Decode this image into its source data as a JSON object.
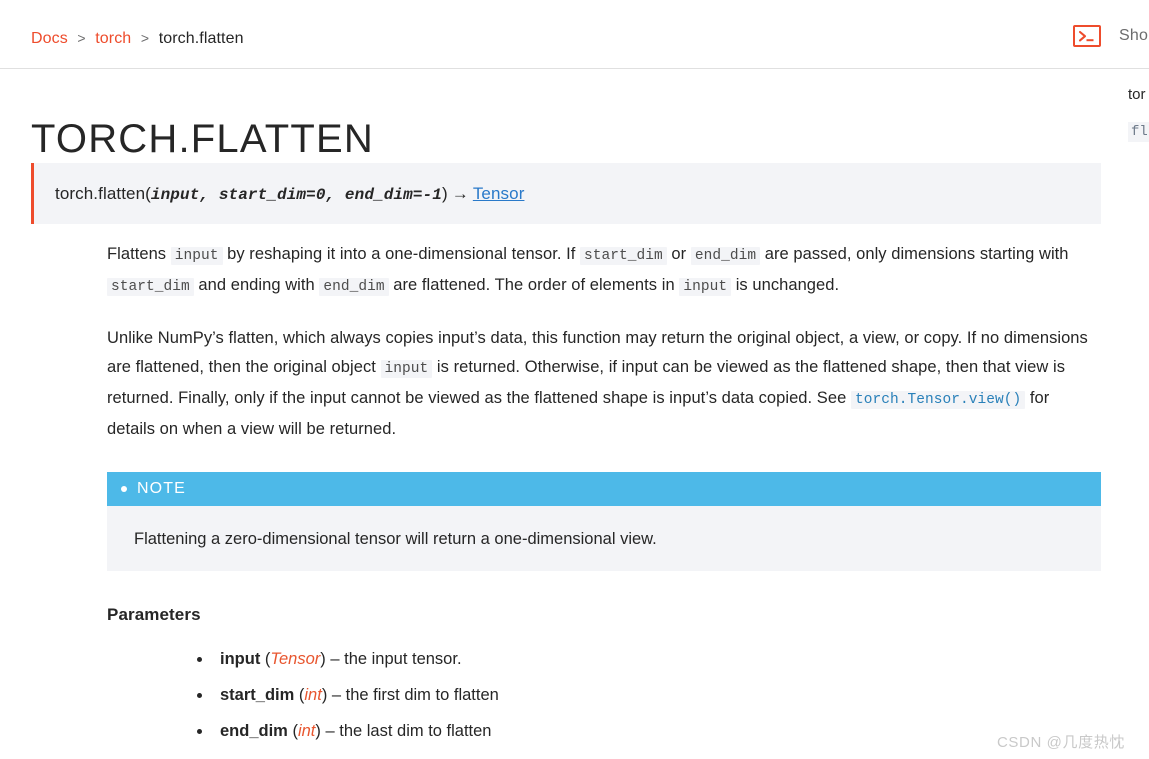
{
  "header": {
    "breadcrumb": {
      "items": [
        {
          "label": "Docs",
          "type": "link"
        },
        {
          "label": "torch",
          "type": "link"
        },
        {
          "label": "torch.flatten",
          "type": "current"
        }
      ],
      "separator": ">"
    },
    "shell": {
      "icon": "terminal-prompt-icon",
      "label": "Sho"
    }
  },
  "right_rail": {
    "title": "tor",
    "code": "fl"
  },
  "page": {
    "title": "TORCH.FLATTEN"
  },
  "signature": {
    "name": "torch.flatten",
    "open_paren": "(",
    "params": "input, start_dim=0, end_dim=-1",
    "close_paren": ")",
    "arrow": "→",
    "return_type": "Tensor",
    "accent_color": "#ee4c2c",
    "background": "#f3f4f7"
  },
  "paragraphs": [
    {
      "id": "desc-1",
      "runs": [
        {
          "t": "text",
          "v": "Flattens "
        },
        {
          "t": "code",
          "v": "input"
        },
        {
          "t": "text",
          "v": " by reshaping it into a one-dimensional tensor. If "
        },
        {
          "t": "code",
          "v": "start_dim"
        },
        {
          "t": "text",
          "v": " or "
        },
        {
          "t": "code",
          "v": "end_dim"
        },
        {
          "t": "text",
          "v": " are passed, only dimensions starting with "
        },
        {
          "t": "code",
          "v": "start_dim"
        },
        {
          "t": "text",
          "v": " and ending with "
        },
        {
          "t": "code",
          "v": "end_dim"
        },
        {
          "t": "text",
          "v": " are flattened. The order of elements in "
        },
        {
          "t": "code",
          "v": "input"
        },
        {
          "t": "text",
          "v": " is unchanged."
        }
      ]
    },
    {
      "id": "desc-2",
      "runs": [
        {
          "t": "text",
          "v": "Unlike NumPy’s flatten, which always copies input’s data, this function may return the original object, a view, or copy. If no dimensions are flattened, then the original object "
        },
        {
          "t": "code",
          "v": "input"
        },
        {
          "t": "text",
          "v": " is returned. Otherwise, if input can be viewed as the flattened shape, then that view is returned. Finally, only if the input cannot be viewed as the flattened shape is input’s data copied. See "
        },
        {
          "t": "link",
          "v": "torch.Tensor.view()"
        },
        {
          "t": "text",
          "v": " for details on when a view will be returned."
        }
      ]
    }
  ],
  "note": {
    "title": "NOTE",
    "text": "Flattening a zero-dimensional tensor will return a one-dimensional view.",
    "header_color": "#4db9e8",
    "body_color": "#f3f4f7"
  },
  "parameters": {
    "heading": "Parameters",
    "items": [
      {
        "name": "input",
        "type": "Tensor",
        "desc": "the input tensor."
      },
      {
        "name": "start_dim",
        "type": "int",
        "desc": "the first dim to flatten"
      },
      {
        "name": "end_dim",
        "type": "int",
        "desc": "the last dim to flatten"
      }
    ]
  },
  "watermark": {
    "text": "CSDN @几度热忱"
  }
}
